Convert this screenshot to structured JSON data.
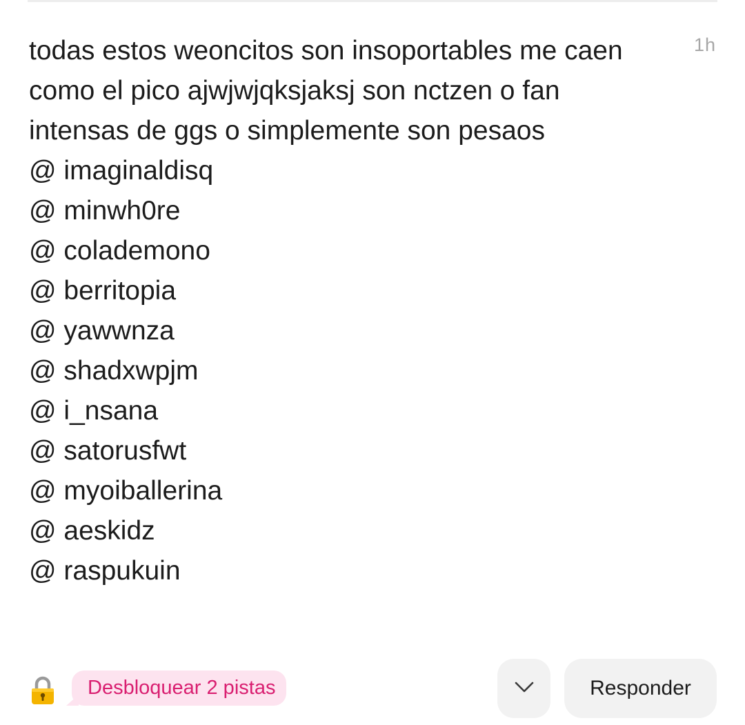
{
  "comment": {
    "time": "1h",
    "body": "todas estos weoncitos son insoportables me caen como el pico ajwjwjqksjaksj son nctzen o fan intensas de ggs o simplemente son pesaos",
    "mentions": [
      "@ imaginaldisq",
      "@ minwh0re",
      "@ colademono",
      "@ berritopia",
      "@ yawwnza",
      "@ shadxwpjm",
      "@ i_nsana",
      "@ satorusfwt",
      "@ myoiballerina",
      "@ aeskidz",
      "@ raspukuin"
    ]
  },
  "footer": {
    "lock_icon": "lock-icon",
    "hint_label": "Desbloquear 2 pistas",
    "hint_color": "#d91e70",
    "hint_background": "#fde3ef",
    "expand_icon": "chevron-down-icon",
    "reply_label": "Responder"
  }
}
